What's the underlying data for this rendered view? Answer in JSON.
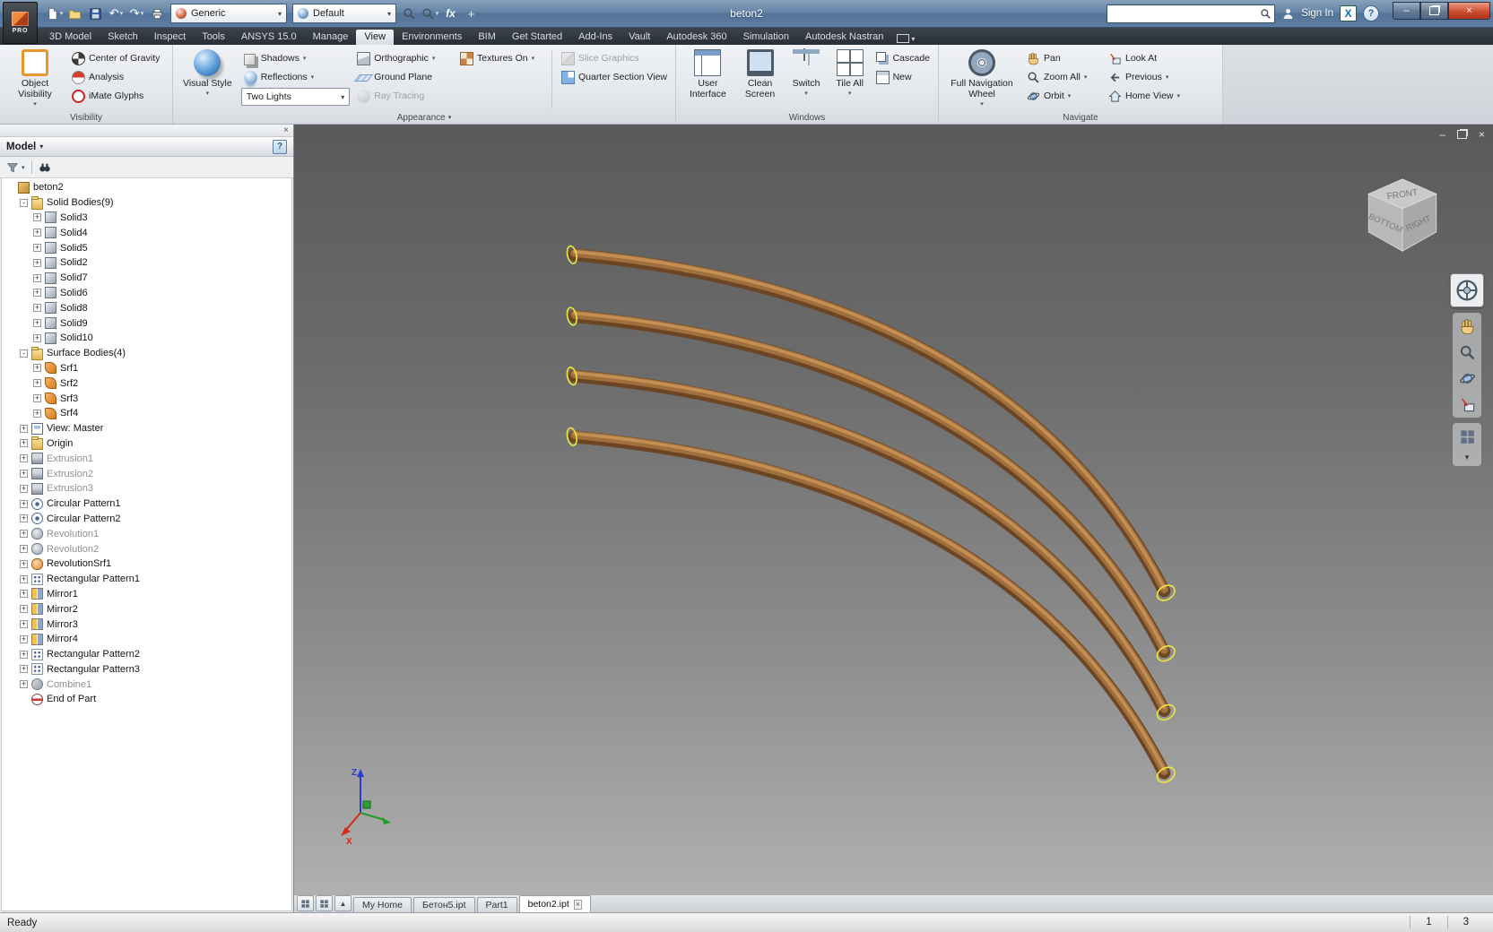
{
  "titlebar": {
    "app_badge": "PRO",
    "title": "beton2",
    "material_select": "Generic",
    "appearance_select": "Default",
    "fx_label": "fx",
    "sign_in": "Sign In",
    "exchange_logo": "X",
    "help": "?"
  },
  "glyphs": {
    "caret": "▾",
    "undo": "↶",
    "redo": "↷",
    "close": "×",
    "minimize": "–",
    "plus": "+",
    "up_arrow": "▲"
  },
  "ribbon": {
    "tabs": [
      {
        "label": "3D Model"
      },
      {
        "label": "Sketch"
      },
      {
        "label": "Inspect"
      },
      {
        "label": "Tools"
      },
      {
        "label": "ANSYS 15.0"
      },
      {
        "label": "Manage"
      },
      {
        "label": "View",
        "active": true
      },
      {
        "label": "Environments"
      },
      {
        "label": "BIM"
      },
      {
        "label": "Get Started"
      },
      {
        "label": "Add-Ins"
      },
      {
        "label": "Vault"
      },
      {
        "label": "Autodesk 360"
      },
      {
        "label": "Simulation"
      },
      {
        "label": "Autodesk Nastran"
      }
    ],
    "panels": {
      "visibility": {
        "title": "Visibility",
        "object_visibility": "Object Visibility",
        "center_of_gravity": "Center of Gravity",
        "analysis": "Analysis",
        "imate_glyphs": "iMate Glyphs"
      },
      "appearance": {
        "title": "Appearance",
        "visual_style": "Visual Style",
        "shadows": "Shadows",
        "reflections": "Reflections",
        "two_lights": "Two Lights",
        "orthographic": "Orthographic",
        "ground_plane": "Ground Plane",
        "ray_tracing": "Ray Tracing",
        "textures_on": "Textures On",
        "slice_graphics": "Slice Graphics",
        "quarter_section_view": "Quarter Section View"
      },
      "windows": {
        "title": "Windows",
        "user_interface": "User Interface",
        "clean_screen": "Clean Screen",
        "switch": "Switch",
        "tile_all": "Tile All",
        "cascade": "Cascade",
        "new": "New"
      },
      "navigate": {
        "title": "Navigate",
        "full_navigation_wheel": "Full Navigation Wheel",
        "pan": "Pan",
        "zoom_all": "Zoom All",
        "orbit": "Orbit",
        "look_at": "Look At",
        "previous": "Previous",
        "home_view": "Home View"
      }
    }
  },
  "browser": {
    "title": "Model",
    "help": "?",
    "tree": [
      {
        "label": "beton2",
        "icon": "part",
        "level": 0,
        "expander": "none"
      },
      {
        "label": "Solid Bodies(9)",
        "icon": "solid-folder",
        "level": 1,
        "expander": "minus"
      },
      {
        "label": "Solid3",
        "icon": "solid",
        "level": 2,
        "expander": "plus"
      },
      {
        "label": "Solid4",
        "icon": "solid",
        "level": 2,
        "expander": "plus"
      },
      {
        "label": "Solid5",
        "icon": "solid",
        "level": 2,
        "expander": "plus"
      },
      {
        "label": "Solid2",
        "icon": "solid",
        "level": 2,
        "expander": "plus"
      },
      {
        "label": "Solid7",
        "icon": "solid",
        "level": 2,
        "expander": "plus"
      },
      {
        "label": "Solid6",
        "icon": "solid",
        "level": 2,
        "expander": "plus"
      },
      {
        "label": "Solid8",
        "icon": "solid",
        "level": 2,
        "expander": "plus"
      },
      {
        "label": "Solid9",
        "icon": "solid",
        "level": 2,
        "expander": "plus"
      },
      {
        "label": "Solid10",
        "icon": "solid",
        "level": 2,
        "expander": "plus"
      },
      {
        "label": "Surface Bodies(4)",
        "icon": "surface-folder",
        "level": 1,
        "expander": "minus"
      },
      {
        "label": "Srf1",
        "icon": "surface",
        "level": 2,
        "expander": "plus"
      },
      {
        "label": "Srf2",
        "icon": "surface",
        "level": 2,
        "expander": "plus"
      },
      {
        "label": "Srf3",
        "icon": "surface",
        "level": 2,
        "expander": "plus"
      },
      {
        "label": "Srf4",
        "icon": "surface",
        "level": 2,
        "expander": "plus"
      },
      {
        "label": "View: Master",
        "icon": "view",
        "level": 1,
        "expander": "plus"
      },
      {
        "label": "Origin",
        "icon": "origin",
        "level": 1,
        "expander": "plus"
      },
      {
        "label": "Extrusion1",
        "icon": "extrusion",
        "level": 1,
        "expander": "plus",
        "muted": true
      },
      {
        "label": "Extrusion2",
        "icon": "extrusion",
        "level": 1,
        "expander": "plus",
        "muted": true
      },
      {
        "label": "Extrusion3",
        "icon": "extrusion",
        "level": 1,
        "expander": "plus",
        "muted": true
      },
      {
        "label": "Circular Pattern1",
        "icon": "circular-pattern",
        "level": 1,
        "expander": "plus"
      },
      {
        "label": "Circular Pattern2",
        "icon": "circular-pattern",
        "level": 1,
        "expander": "plus"
      },
      {
        "label": "Revolution1",
        "icon": "revolution",
        "level": 1,
        "expander": "plus",
        "muted": true
      },
      {
        "label": "Revolution2",
        "icon": "revolution",
        "level": 1,
        "expander": "plus",
        "muted": true
      },
      {
        "label": "RevolutionSrf1",
        "icon": "revolution-srf",
        "level": 1,
        "expander": "plus"
      },
      {
        "label": "Rectangular Pattern1",
        "icon": "rect-pattern",
        "level": 1,
        "expander": "plus"
      },
      {
        "label": "Mirror1",
        "icon": "mirror",
        "level": 1,
        "expander": "plus"
      },
      {
        "label": "Mirror2",
        "icon": "mirror",
        "level": 1,
        "expander": "plus"
      },
      {
        "label": "Mirror3",
        "icon": "mirror",
        "level": 1,
        "expander": "plus"
      },
      {
        "label": "Mirror4",
        "icon": "mirror",
        "level": 1,
        "expander": "plus"
      },
      {
        "label": "Rectangular Pattern2",
        "icon": "rect-pattern",
        "level": 1,
        "expander": "plus"
      },
      {
        "label": "Rectangular Pattern3",
        "icon": "rect-pattern",
        "level": 1,
        "expander": "plus"
      },
      {
        "label": "Combine1",
        "icon": "combine",
        "level": 1,
        "expander": "plus",
        "muted": true
      },
      {
        "label": "End of Part",
        "icon": "end-of-part",
        "level": 1,
        "expander": "none"
      }
    ]
  },
  "viewport": {
    "viewcube_labels": {
      "top": "FRONT",
      "left": "BOTTOM",
      "right": "RIGHT"
    },
    "triad": {
      "z": "Z",
      "x": "X"
    }
  },
  "document_tabs": [
    {
      "label": "My Home"
    },
    {
      "label": "Бетон5.ipt"
    },
    {
      "label": "Part1"
    },
    {
      "label": "beton2.ipt",
      "active": true
    }
  ],
  "status": {
    "message": "Ready",
    "cells": [
      "1",
      "3"
    ]
  },
  "colors": {
    "tube": "#a06f3c",
    "tube_dark": "#6b4524",
    "tube_light": "#c89256",
    "endcap_yellow": "#ece73b",
    "viewport_top": "#5a5a5a",
    "viewport_bottom": "#b0b0b0",
    "titlebar_blue": "#5d7da2",
    "ribbon_bg": "#e7eaee",
    "tabrow_dark": "#2a3037"
  }
}
